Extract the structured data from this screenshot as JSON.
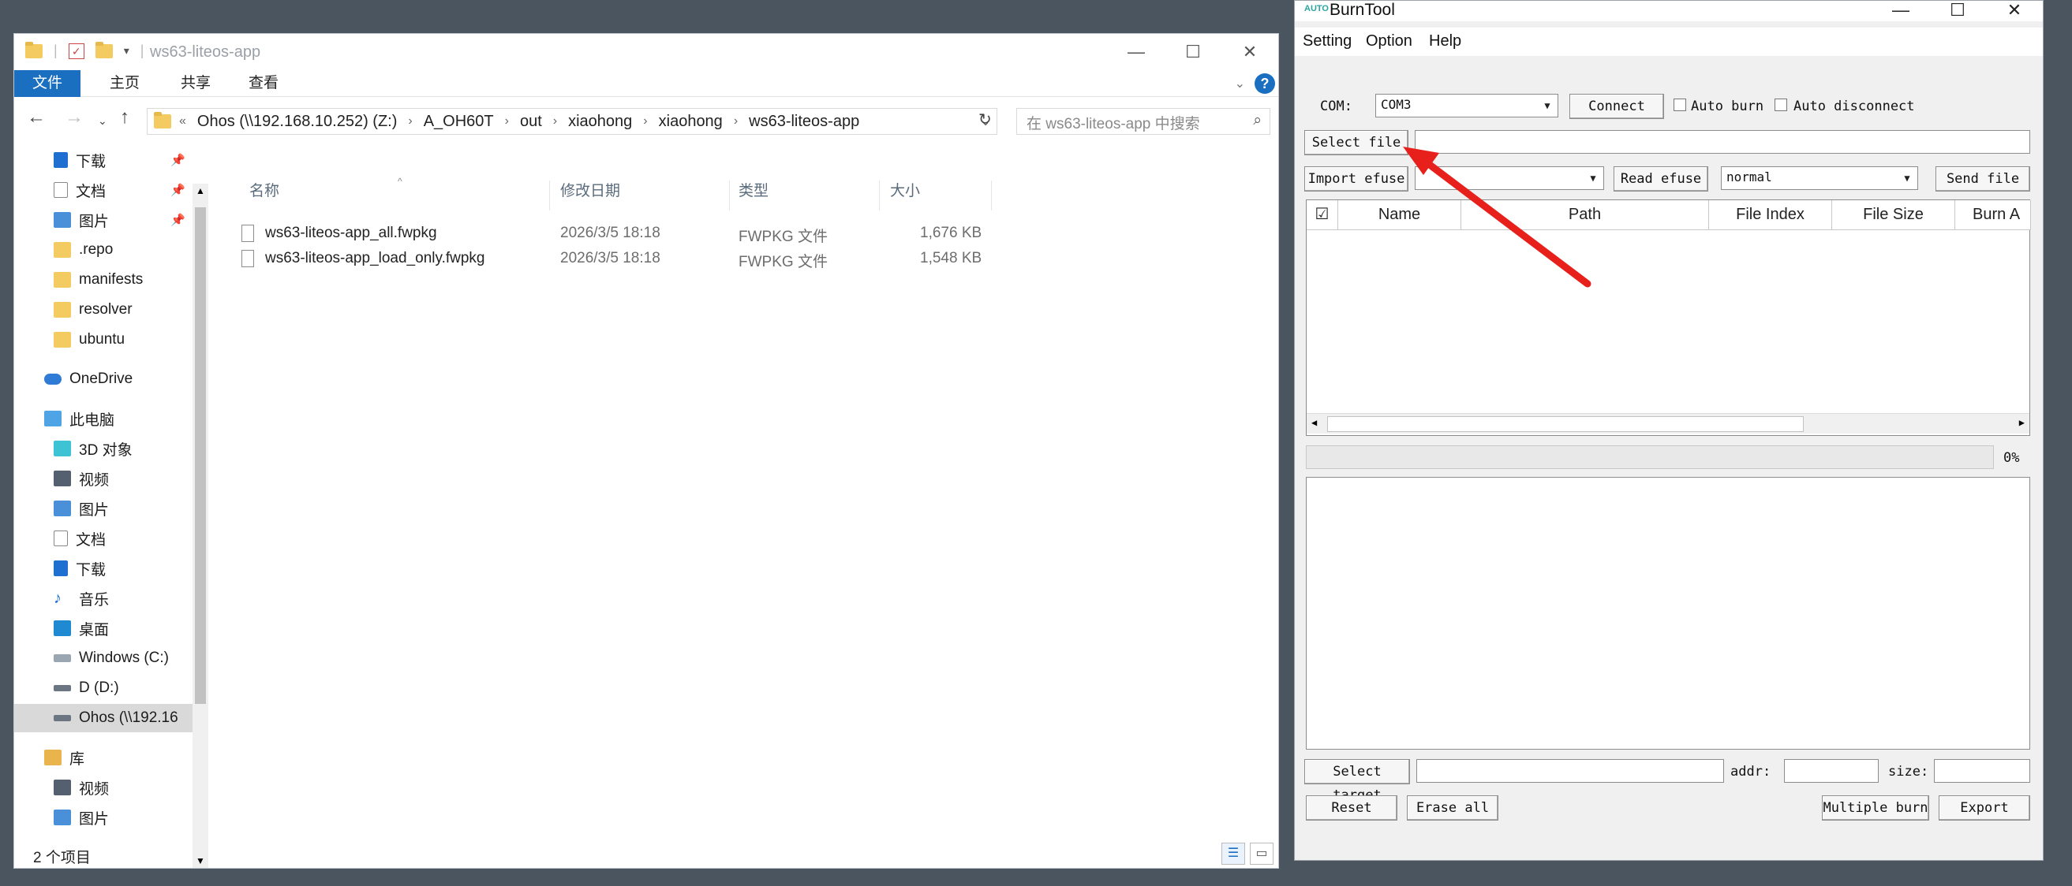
{
  "explorer": {
    "window_title": "ws63-liteos-app",
    "window_buttons": [
      "—",
      "☐",
      "✕"
    ],
    "ribbon_tabs": [
      "文件",
      "主页",
      "共享",
      "查看"
    ],
    "address": [
      "Ohos (\\\\192.168.10.252) (Z:)",
      "A_OH60T",
      "out",
      "xiaohong",
      "xiaohong",
      "ws63-liteos-app"
    ],
    "address_prefix": "«",
    "search_placeholder": "在 ws63-liteos-app 中搜索",
    "nav_items": [
      {
        "label": "下载",
        "icon": "download-icon",
        "pinned": true
      },
      {
        "label": "文档",
        "icon": "document-icon",
        "pinned": true
      },
      {
        "label": "图片",
        "icon": "picture-icon",
        "pinned": true
      },
      {
        "label": ".repo",
        "icon": "folder-icon"
      },
      {
        "label": "manifests",
        "icon": "folder-icon"
      },
      {
        "label": "resolver",
        "icon": "folder-icon"
      },
      {
        "label": "ubuntu",
        "icon": "folder-icon"
      },
      {
        "label": "OneDrive",
        "icon": "cloud-icon"
      },
      {
        "label": "此电脑",
        "icon": "computer-icon"
      },
      {
        "label": "3D 对象",
        "icon": "cube-icon"
      },
      {
        "label": "视频",
        "icon": "video-icon"
      },
      {
        "label": "图片",
        "icon": "picture-icon"
      },
      {
        "label": "文档",
        "icon": "document-icon"
      },
      {
        "label": "下载",
        "icon": "download-icon"
      },
      {
        "label": "音乐",
        "icon": "music-icon"
      },
      {
        "label": "桌面",
        "icon": "desktop-icon"
      },
      {
        "label": "Windows (C:)",
        "icon": "drive-icon"
      },
      {
        "label": "D (D:)",
        "icon": "drive-icon"
      },
      {
        "label": "Ohos (\\\\192.16",
        "icon": "network-drive-icon",
        "selected": true
      },
      {
        "label": "库",
        "icon": "library-icon"
      },
      {
        "label": "视频",
        "icon": "video-icon"
      },
      {
        "label": "图片",
        "icon": "picture-icon"
      }
    ],
    "columns": [
      "名称",
      "修改日期",
      "类型",
      "大小"
    ],
    "files": [
      {
        "name": "ws63-liteos-app_all.fwpkg",
        "date": "2026/3/5 18:18",
        "type": "FWPKG 文件",
        "size": "1,676 KB"
      },
      {
        "name": "ws63-liteos-app_load_only.fwpkg",
        "date": "2026/3/5 18:18",
        "type": "FWPKG 文件",
        "size": "1,548 KB"
      }
    ],
    "status": "2 个项目"
  },
  "burntool": {
    "title": "BurnTool",
    "logo_text": "AUTO",
    "window_buttons": [
      "—",
      "☐",
      "✕"
    ],
    "menu": [
      "Setting",
      "Option",
      "Help"
    ],
    "com_label": "COM:",
    "com_value": "COM3",
    "connect": "Connect",
    "auto_burn": "Auto burn",
    "auto_disconnect": "Auto disconnect",
    "select_file": "Select file",
    "import_efuse": "Import efuse",
    "read_efuse": "Read efuse",
    "mode_value": "normal",
    "send_file": "Send file",
    "grid_columns": [
      "Name",
      "Path",
      "File Index",
      "File Size",
      "Burn A"
    ],
    "progress_text": "0%",
    "progress": 0,
    "select_target": "Select target",
    "addr_label": "addr:",
    "size_label": "size:",
    "reset": "Reset",
    "erase_all": "Erase all",
    "multiple_burn": "Multiple burn",
    "export": "Export"
  },
  "colors": {
    "ribbon_file_tab": "#1a6fc1",
    "folder": "#f4cb60",
    "annotation_arrow": "#e8201c",
    "desktop": "#4b5560"
  }
}
